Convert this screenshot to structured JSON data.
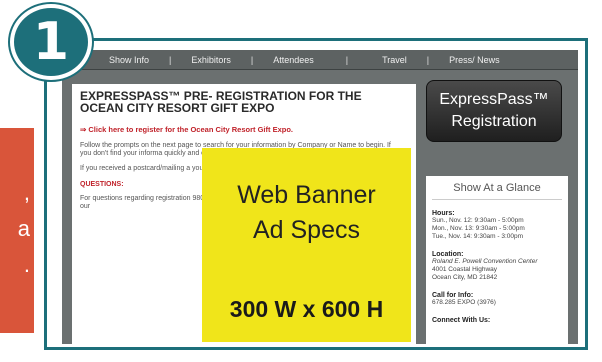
{
  "side_panel": {
    "lines": [
      ",",
      "a",
      "."
    ]
  },
  "badge": {
    "number": "1"
  },
  "nav": {
    "items": [
      "Show Info",
      "Exhibitors",
      "Attendees",
      "Travel",
      "Press/ News"
    ],
    "separator": "|"
  },
  "main": {
    "headline": "EXPRESSPASS™ PRE- REGISTRATION FOR THE OCEAN CITY RESORT GIFT EXPO",
    "register_link": "⇒ Click here to register for the Ocean City Resort Gift Expo.",
    "para1": "Follow the prompts on the next page to search for your information by Company or Name to begin. If you don't find your informa quickly and easily. We'll send you with our onsite readers, and quickly",
    "para2": "If you received a postcard/mailing a your registration!",
    "questions_label": "QUESTIONS:",
    "para3": "For questions regarding registration 980.233.3781, Ext 1 or via email – online registration, please use our"
  },
  "express_button": {
    "line1": "ExpressPass™",
    "line2": "Registration"
  },
  "glance": {
    "title": "Show At a Glance",
    "hours_label": "Hours:",
    "hours": [
      "Sun., Nov. 12: 9:30am - 5:00pm",
      "Mon., Nov. 13: 9:30am - 5:00pm",
      "Tue., Nov. 14: 9:30am - 3:00pm"
    ],
    "location_label": "Location:",
    "location": [
      "Roland E. Powell Convention Center",
      "4001 Coastal Highway",
      "Ocean City, MD 21842"
    ],
    "call_label": "Call for Info:",
    "call": "678.285 EXPO (3976)",
    "connect_label": "Connect With Us:"
  },
  "ad": {
    "title_line1": "Web Banner",
    "title_line2": "Ad Specs",
    "size": "300 W x 600 H"
  },
  "colors": {
    "teal": "#1d6f7a",
    "orange": "#d9553a",
    "yellow": "#f0e51a",
    "red_link": "#c0222a"
  }
}
